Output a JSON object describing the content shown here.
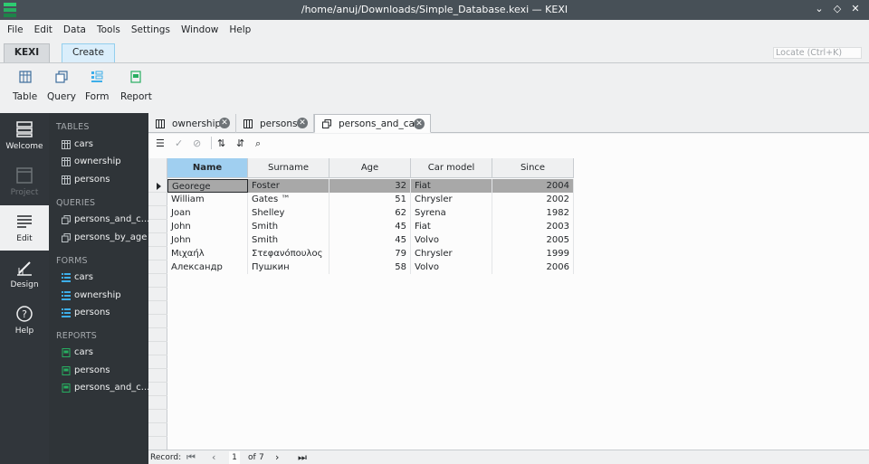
{
  "window": {
    "title": "/home/anuj/Downloads/Simple_Database.kexi — KEXI"
  },
  "menu": [
    "File",
    "Edit",
    "Data",
    "Tools",
    "Settings",
    "Window",
    "Help"
  ],
  "ribbon": {
    "tabs": [
      "KEXI",
      "Create"
    ],
    "active_tab": "Create",
    "buttons": [
      "Table",
      "Query",
      "Form",
      "Report"
    ],
    "locate_placeholder": "Locate (Ctrl+K)"
  },
  "leftbar": [
    "Welcome",
    "Project",
    "Edit",
    "Design",
    "Help"
  ],
  "navigator": {
    "tables": {
      "label": "TABLES",
      "items": [
        "cars",
        "ownership",
        "persons"
      ]
    },
    "queries": {
      "label": "QUERIES",
      "items": [
        "persons_and_c...",
        "persons_by_age"
      ]
    },
    "forms": {
      "label": "FORMS",
      "items": [
        "cars",
        "ownership",
        "persons"
      ]
    },
    "reports": {
      "label": "REPORTS",
      "items": [
        "cars",
        "persons",
        "persons_and_c..."
      ]
    }
  },
  "doc_tabs": [
    "ownership",
    "persons",
    "persons_and_cars"
  ],
  "active_doc_tab": "persons_and_cars",
  "grid": {
    "columns": [
      "Name",
      "Surname",
      "Age",
      "Car model",
      "Since"
    ],
    "rows": [
      [
        "Georege",
        "Foster",
        "32",
        "Fiat",
        "2004"
      ],
      [
        "William",
        "Gates ™",
        "51",
        "Chrysler",
        "2002"
      ],
      [
        "Joan",
        "Shelley",
        "62",
        "Syrena",
        "1982"
      ],
      [
        "John",
        "Smith",
        "45",
        "Fiat",
        "2003"
      ],
      [
        "John",
        "Smith",
        "45",
        "Volvo",
        "2005"
      ],
      [
        "Μιχαήλ",
        "Στεφανόπουλος",
        "79",
        "Chrysler",
        "1999"
      ],
      [
        "Александр",
        "Пушкин",
        "58",
        "Volvo",
        "2006"
      ]
    ]
  },
  "record_nav": {
    "label": "Record:",
    "current": "1",
    "of_label": "of",
    "total": "7"
  },
  "colors": {
    "accent": "#3daee9",
    "sidebar": "#31363b",
    "selected_header": "#a0cff0"
  }
}
